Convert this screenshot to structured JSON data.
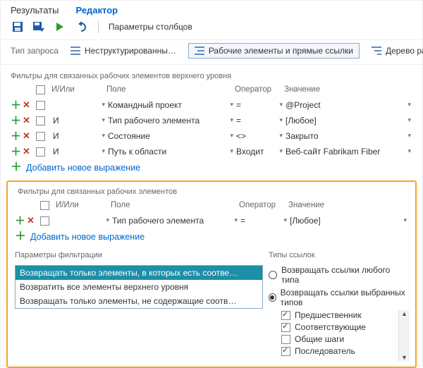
{
  "tabs": {
    "results": "Результаты",
    "editor": "Редактор"
  },
  "toolbar": {
    "params": "Параметры столбцов"
  },
  "qtype": {
    "label": "Тип запроса",
    "flat": "Неструктурированны…",
    "direct": "Рабочие элементы и прямые ссылки",
    "tree": "Дерево рабо…"
  },
  "top_section_title": "Фильтры для связанных рабочих элементов верхнего уровня",
  "cols": {
    "andor": "И/Или",
    "field": "Поле",
    "op": "Оператор",
    "val": "Значение"
  },
  "filters_top": [
    {
      "andor": "",
      "field": "Командный проект",
      "op": "=",
      "val": "@Project"
    },
    {
      "andor": "И",
      "field": "Тип рабочего элемента",
      "op": "=",
      "val": "[Любое]"
    },
    {
      "andor": "И",
      "field": "Состояние",
      "op": "<>",
      "val": "Закрыто"
    },
    {
      "andor": "И",
      "field": "Путь к области",
      "op": "Входит",
      "val": "Веб-сайт Fabrikam Fiber"
    }
  ],
  "add_expr": "Добавить новое выражение",
  "linked_section_title": "Фильтры для связанных рабочих элементов",
  "filters_linked": [
    {
      "andor": "",
      "field": "Тип рабочего элемента",
      "op": "=",
      "val": "[Любое]"
    }
  ],
  "filter_params_title": "Параметры фильтрации",
  "filter_params_items": [
    "Возвращать только элементы, в которых есть соотве…",
    "Возвратить все элементы верхнего уровня",
    "Возвращать только элементы, не содержащие соотв…"
  ],
  "link_types_title": "Типы ссылок",
  "link_types_radio": [
    "Возвращать ссылки любого типа",
    "Возвращать ссылки выбранных типов"
  ],
  "link_types_checks": [
    {
      "label": "Предшественник",
      "checked": true
    },
    {
      "label": "Соответствующие",
      "checked": true
    },
    {
      "label": "Общие шаги",
      "checked": false
    },
    {
      "label": "Последователь",
      "checked": true
    }
  ]
}
